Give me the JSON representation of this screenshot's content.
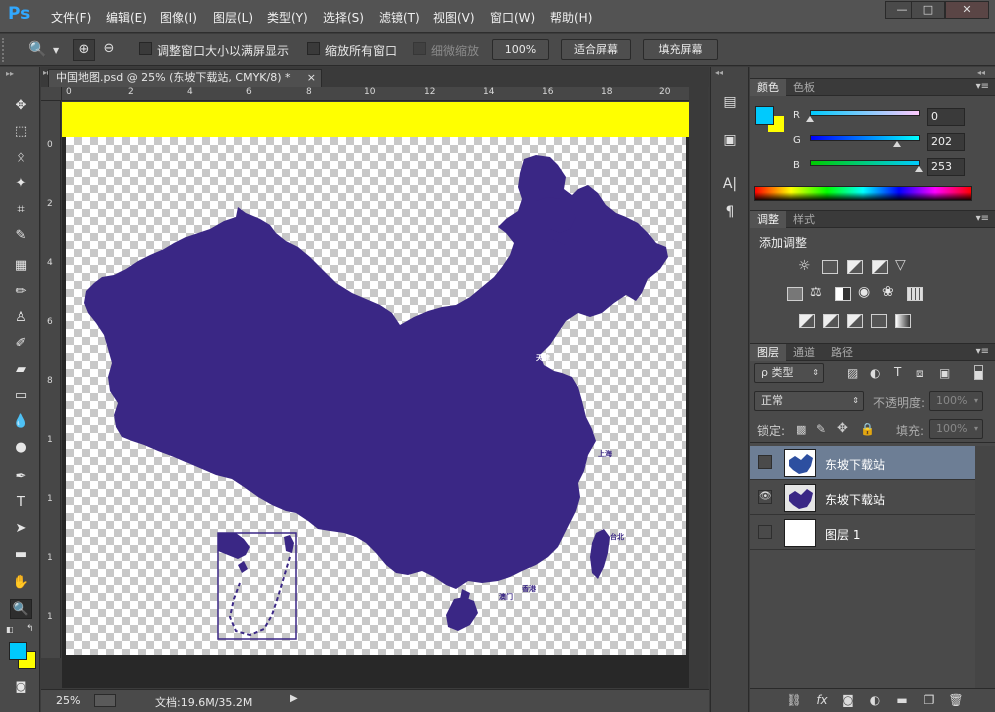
{
  "app": {
    "logo": "Ps"
  },
  "menu": [
    "文件(F)",
    "编辑(E)",
    "图像(I)",
    "图层(L)",
    "类型(Y)",
    "选择(S)",
    "滤镜(T)",
    "视图(V)",
    "窗口(W)",
    "帮助(H)"
  ],
  "window_controls": {
    "minimize": "—",
    "maximize": "□",
    "close": "✕"
  },
  "options": {
    "resize_windows_label": "调整窗口大小以满屏显示",
    "zoom_all_label": "缩放所有窗口",
    "scrubby_label": "细微缩放",
    "zoom_100": "100%",
    "fit_screen": "适合屏幕",
    "fill_screen": "填充屏幕"
  },
  "document": {
    "tab_title": "中国地图.psd @ 25% (东坡下载站, CMYK/8) *",
    "tab_close": "×",
    "ruler_top": [
      "0",
      "2",
      "4",
      "6",
      "8",
      "10",
      "12",
      "14",
      "16",
      "18",
      "20"
    ],
    "ruler_left": [
      "0",
      "2",
      "4",
      "6",
      "8",
      "1",
      "1",
      "1",
      "1"
    ],
    "map_labels": [
      "天津",
      "上海",
      "台北",
      "香港",
      "澳门"
    ],
    "status_zoom": "25%",
    "status_doc": "文档:19.6M/35.2M"
  },
  "color_panel": {
    "tabs": [
      "颜色",
      "色板"
    ],
    "r_label": "R",
    "g_label": "G",
    "b_label": "B",
    "r": "0",
    "g": "202",
    "b": "253",
    "foreground": "#00cafd",
    "background": "#ffff00",
    "r_pos": 0.0,
    "g_pos": 0.79,
    "b_pos": 0.99
  },
  "adjustments_panel": {
    "tabs": [
      "调整",
      "样式"
    ],
    "heading": "添加调整"
  },
  "layers_panel": {
    "tabs": [
      "图层",
      "通道",
      "路径"
    ],
    "filter_label": "ρ 类型",
    "blend_mode": "正常",
    "opacity_label": "不透明度:",
    "opacity_value": "100%",
    "lock_label": "锁定:",
    "fill_label": "填充:",
    "fill_value": "100%",
    "layers": [
      {
        "name": "东坡下载站",
        "visible": false,
        "selected": true
      },
      {
        "name": "东坡下载站",
        "visible": true,
        "selected": false
      },
      {
        "name": "图层 1",
        "visible": false,
        "selected": false
      }
    ]
  },
  "colors": {
    "map_fill": "#3a2785",
    "selection": "#6d7e95",
    "accent": "#31a8ff"
  }
}
